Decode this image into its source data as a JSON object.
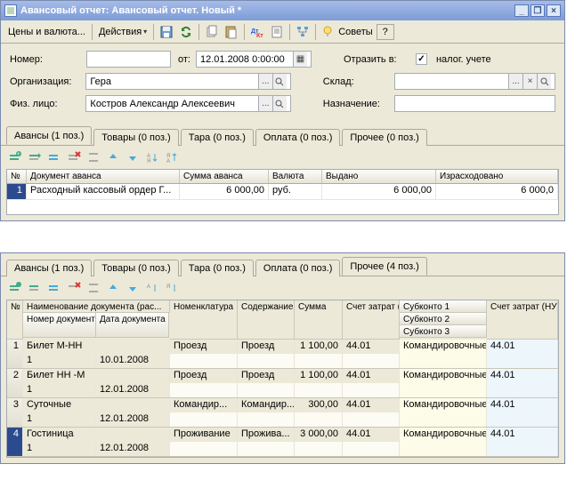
{
  "window": {
    "title": "Авансовый отчет: Авансовый отчет. Новый *"
  },
  "toolbar": {
    "currency": "Цены и валюта...",
    "actions": "Действия",
    "advice": "Советы"
  },
  "form": {
    "number_label": "Номер:",
    "from_label": "от:",
    "date_value": "12.01.2008 0:00:00",
    "reflect_label": "Отразить в:",
    "tax_label": "налог. учете",
    "org_label": "Организация:",
    "org_value": "Гера",
    "warehouse_label": "Склад:",
    "person_label": "Физ. лицо:",
    "person_value": "Костров Александр Алексеевич",
    "purpose_label": "Назначение:"
  },
  "tabs1": {
    "advances": "Авансы (1 поз.)",
    "goods": "Товары (0 поз.)",
    "tare": "Тара (0 поз.)",
    "payment": "Оплата (0 поз.)",
    "other": "Прочее (0 поз.)"
  },
  "grid1": {
    "cols": {
      "num": "№",
      "doc": "Документ аванса",
      "sum": "Сумма аванса",
      "currency": "Валюта",
      "issued": "Выдано",
      "spent": "Израсходовано"
    },
    "row": {
      "num": "1",
      "doc": "Расходный кассовый ордер Г...",
      "sum": "6 000,00",
      "currency": "руб.",
      "issued": "6 000,00",
      "spent": "6 000,0"
    }
  },
  "tabs2": {
    "advances": "Авансы (1 поз.)",
    "goods": "Товары (0 поз.)",
    "tare": "Тара (0 поз.)",
    "payment": "Оплата (0 поз.)",
    "other": "Прочее (4 поз.)"
  },
  "grid2": {
    "cols": {
      "num": "№",
      "docname": "Наименование документа (рас...",
      "docnum": "Номер документа",
      "docdate": "Дата документа",
      "nomen": "Номенклатура",
      "content": "Содержание",
      "sum": "Сумма",
      "acct_bu": "Счет затрат (БУ)",
      "sub1": "Субконто 1",
      "sub2": "Субконто 2",
      "sub3": "Субконто 3",
      "acct_nu": "Счет затрат (НУ)"
    },
    "rows": [
      {
        "n": "1",
        "name": "Билет М-НН",
        "num": "1",
        "date": "10.01.2008",
        "nomen": "Проезд",
        "content": "Проезд",
        "sum": "1 100,00",
        "acct": "44.01",
        "sub1": "Командировочные",
        "acct_nu": "44.01"
      },
      {
        "n": "2",
        "name": "Билет НН -М",
        "num": "1",
        "date": "12.01.2008",
        "nomen": "Проезд",
        "content": "Проезд",
        "sum": "1 100,00",
        "acct": "44.01",
        "sub1": "Командировочные",
        "acct_nu": "44.01"
      },
      {
        "n": "3",
        "name": "Суточные",
        "num": "1",
        "date": "12.01.2008",
        "nomen": "Командир...",
        "content": "Командир...",
        "sum": "300,00",
        "acct": "44.01",
        "sub1": "Командировочные",
        "acct_nu": "44.01"
      },
      {
        "n": "4",
        "name": "Гостиница",
        "num": "1",
        "date": "12.01.2008",
        "nomen": "Проживание",
        "content": "Прожива...",
        "sum": "3 000,00",
        "acct": "44.01",
        "sub1": "Командировочные",
        "acct_nu": "44.01"
      }
    ]
  }
}
